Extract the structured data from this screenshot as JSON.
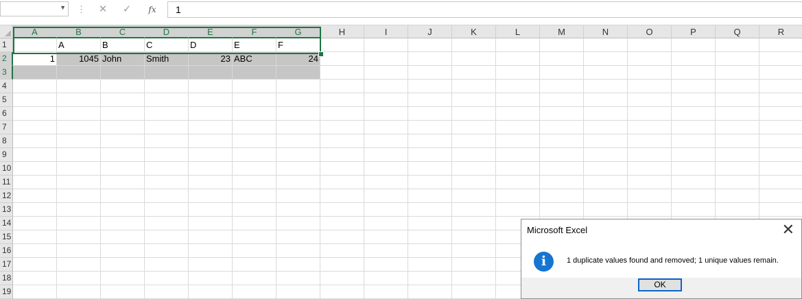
{
  "formula_bar": {
    "name_box": "",
    "cancel_glyph": "✕",
    "enter_glyph": "✓",
    "fx_label": "fx",
    "formula_value": "1"
  },
  "columns": [
    "A",
    "B",
    "C",
    "D",
    "E",
    "F",
    "G",
    "H",
    "I",
    "J",
    "K",
    "L",
    "M",
    "N",
    "O",
    "P",
    "Q",
    "R"
  ],
  "rows": [
    "1",
    "2",
    "3",
    "4",
    "5",
    "6",
    "7",
    "8",
    "9",
    "10",
    "11",
    "12",
    "13",
    "14",
    "15",
    "16",
    "17",
    "18",
    "19"
  ],
  "cells": {
    "row1": [
      "",
      "A",
      "B",
      "C",
      "D",
      "E",
      "F"
    ],
    "row2": [
      "1",
      "1045",
      "John",
      "Smith",
      "23",
      "ABC",
      "24"
    ]
  },
  "dialog": {
    "title": "Microsoft Excel",
    "close_glyph": "✕",
    "icon_glyph": "i",
    "message": "1 duplicate values found and removed; 1 unique values remain.",
    "ok_label": "OK"
  },
  "colors": {
    "selection": "#217346",
    "info_icon": "#1675d1",
    "selection_shade": "#c6c6c6"
  }
}
